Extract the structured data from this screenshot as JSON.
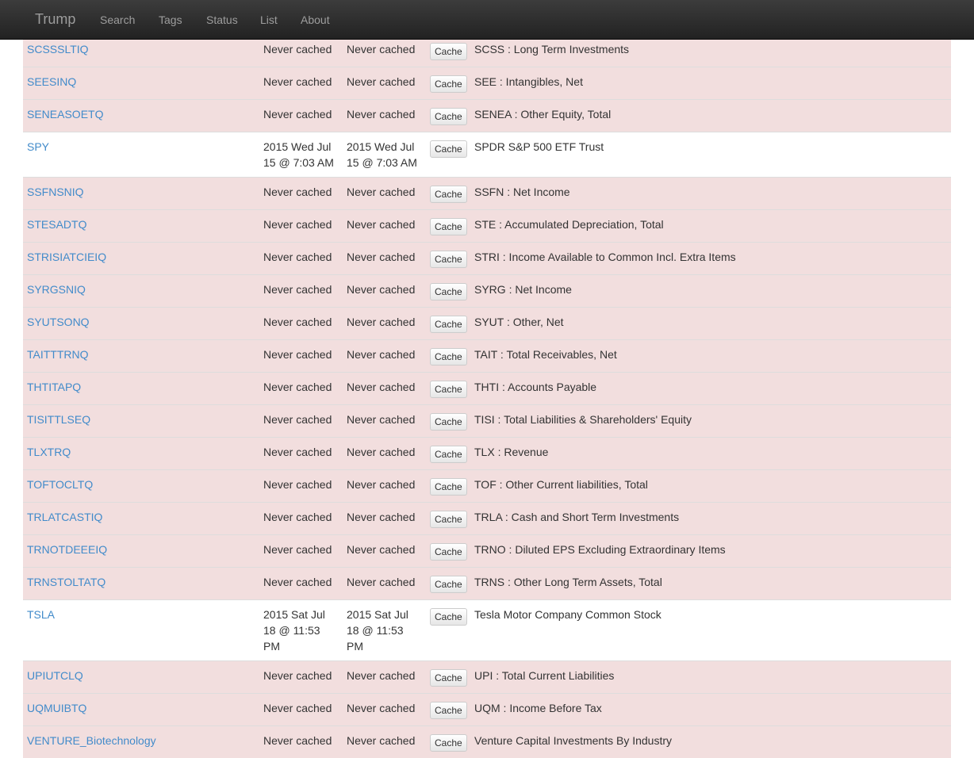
{
  "navbar": {
    "brand": "Trump",
    "links": [
      "Search",
      "Tags",
      "Status",
      "List",
      "About"
    ]
  },
  "rows": [
    {
      "symbol": "SCSSSLTIQ",
      "date1": "Never cached",
      "date2": "Never cached",
      "button": "Cache",
      "desc": "SCSS : Long Term Investments",
      "status": "danger"
    },
    {
      "symbol": "SEESINQ",
      "date1": "Never cached",
      "date2": "Never cached",
      "button": "Cache",
      "desc": "SEE : Intangibles, Net",
      "status": "danger"
    },
    {
      "symbol": "SENEASOETQ",
      "date1": "Never cached",
      "date2": "Never cached",
      "button": "Cache",
      "desc": "SENEA : Other Equity, Total",
      "status": "danger"
    },
    {
      "symbol": "SPY",
      "date1": "2015 Wed Jul 15 @ 7:03 AM",
      "date2": "2015 Wed Jul 15 @ 7:03 AM",
      "button": "Cache",
      "desc": "SPDR S&P 500 ETF Trust",
      "status": "plain"
    },
    {
      "symbol": "SSFNSNIQ",
      "date1": "Never cached",
      "date2": "Never cached",
      "button": "Cache",
      "desc": "SSFN : Net Income",
      "status": "danger"
    },
    {
      "symbol": "STESADTQ",
      "date1": "Never cached",
      "date2": "Never cached",
      "button": "Cache",
      "desc": "STE : Accumulated Depreciation, Total",
      "status": "danger"
    },
    {
      "symbol": "STRISIATCIEIQ",
      "date1": "Never cached",
      "date2": "Never cached",
      "button": "Cache",
      "desc": "STRI : Income Available to Common Incl. Extra Items",
      "status": "danger"
    },
    {
      "symbol": "SYRGSNIQ",
      "date1": "Never cached",
      "date2": "Never cached",
      "button": "Cache",
      "desc": "SYRG : Net Income",
      "status": "danger"
    },
    {
      "symbol": "SYUTSONQ",
      "date1": "Never cached",
      "date2": "Never cached",
      "button": "Cache",
      "desc": "SYUT : Other, Net",
      "status": "danger"
    },
    {
      "symbol": "TAITTTRNQ",
      "date1": "Never cached",
      "date2": "Never cached",
      "button": "Cache",
      "desc": "TAIT : Total Receivables, Net",
      "status": "danger"
    },
    {
      "symbol": "THTITAPQ",
      "date1": "Never cached",
      "date2": "Never cached",
      "button": "Cache",
      "desc": "THTI : Accounts Payable",
      "status": "danger"
    },
    {
      "symbol": "TISITTLSEQ",
      "date1": "Never cached",
      "date2": "Never cached",
      "button": "Cache",
      "desc": "TISI : Total Liabilities & Shareholders' Equity",
      "status": "danger"
    },
    {
      "symbol": "TLXTRQ",
      "date1": "Never cached",
      "date2": "Never cached",
      "button": "Cache",
      "desc": "TLX : Revenue",
      "status": "danger"
    },
    {
      "symbol": "TOFTOCLTQ",
      "date1": "Never cached",
      "date2": "Never cached",
      "button": "Cache",
      "desc": "TOF : Other Current liabilities, Total",
      "status": "danger"
    },
    {
      "symbol": "TRLATCASTIQ",
      "date1": "Never cached",
      "date2": "Never cached",
      "button": "Cache",
      "desc": "TRLA : Cash and Short Term Investments",
      "status": "danger"
    },
    {
      "symbol": "TRNOTDEEEIQ",
      "date1": "Never cached",
      "date2": "Never cached",
      "button": "Cache",
      "desc": "TRNO : Diluted EPS Excluding Extraordinary Items",
      "status": "danger"
    },
    {
      "symbol": "TRNSTOLTATQ",
      "date1": "Never cached",
      "date2": "Never cached",
      "button": "Cache",
      "desc": "TRNS : Other Long Term Assets, Total",
      "status": "danger"
    },
    {
      "symbol": "TSLA",
      "date1": "2015 Sat Jul 18 @ 11:53 PM",
      "date2": "2015 Sat Jul 18 @ 11:53 PM",
      "button": "Cache",
      "desc": "Tesla Motor Company Common Stock",
      "status": "plain"
    },
    {
      "symbol": "UPIUTCLQ",
      "date1": "Never cached",
      "date2": "Never cached",
      "button": "Cache",
      "desc": "UPI : Total Current Liabilities",
      "status": "danger"
    },
    {
      "symbol": "UQMUIBTQ",
      "date1": "Never cached",
      "date2": "Never cached",
      "button": "Cache",
      "desc": "UQM : Income Before Tax",
      "status": "danger"
    },
    {
      "symbol": "VENTURE_Biotechnology",
      "date1": "Never cached",
      "date2": "Never cached",
      "button": "Cache",
      "desc": "Venture Capital Investments By Industry",
      "status": "danger"
    }
  ]
}
